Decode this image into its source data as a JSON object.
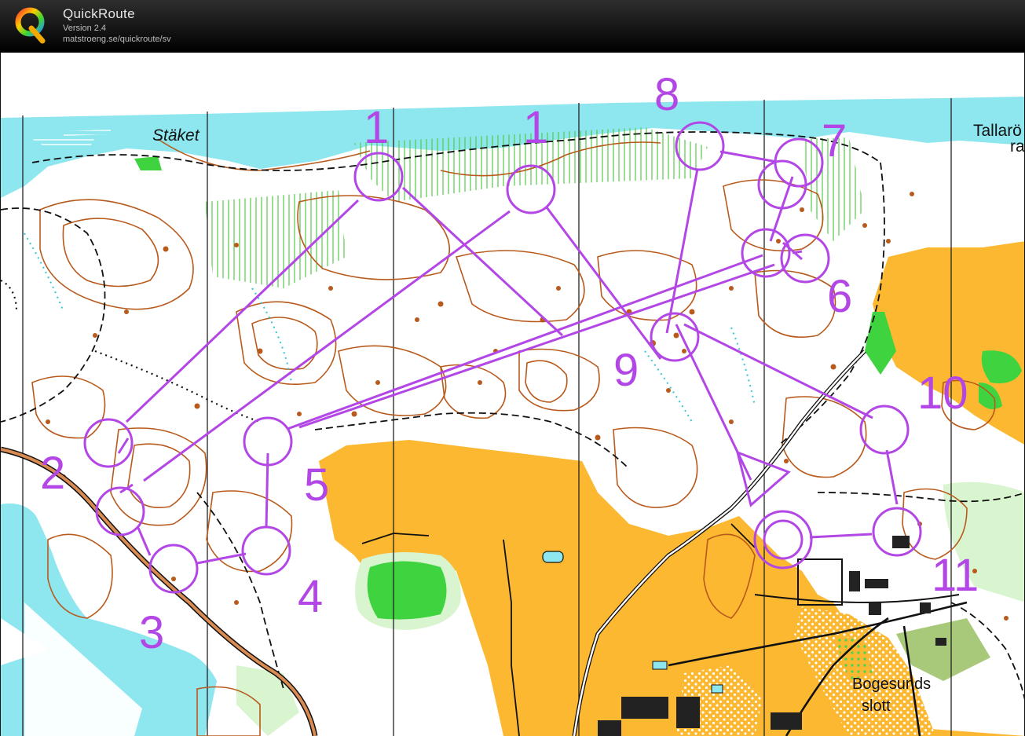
{
  "header": {
    "app_name": "QuickRoute",
    "version": "Version 2.4",
    "url": "matstroeng.se/quickroute/sv"
  },
  "map": {
    "labels": {
      "staket": "Stäket",
      "tallaro": "Tallarö",
      "tallaro_suffix": "ra",
      "bogesunds": "Bogesunds",
      "slott": "slott"
    },
    "course": {
      "color": "#b347e6",
      "control_numbers": [
        "1",
        "1",
        "2",
        "3",
        "4",
        "5",
        "6",
        "7",
        "8",
        "9",
        "10",
        "11"
      ]
    },
    "colors": {
      "water": "#8ee6ef",
      "open_land": "#fbb830",
      "green": "#3fd43f",
      "contour": "#b85a1c",
      "paper": "#ffffff"
    }
  }
}
